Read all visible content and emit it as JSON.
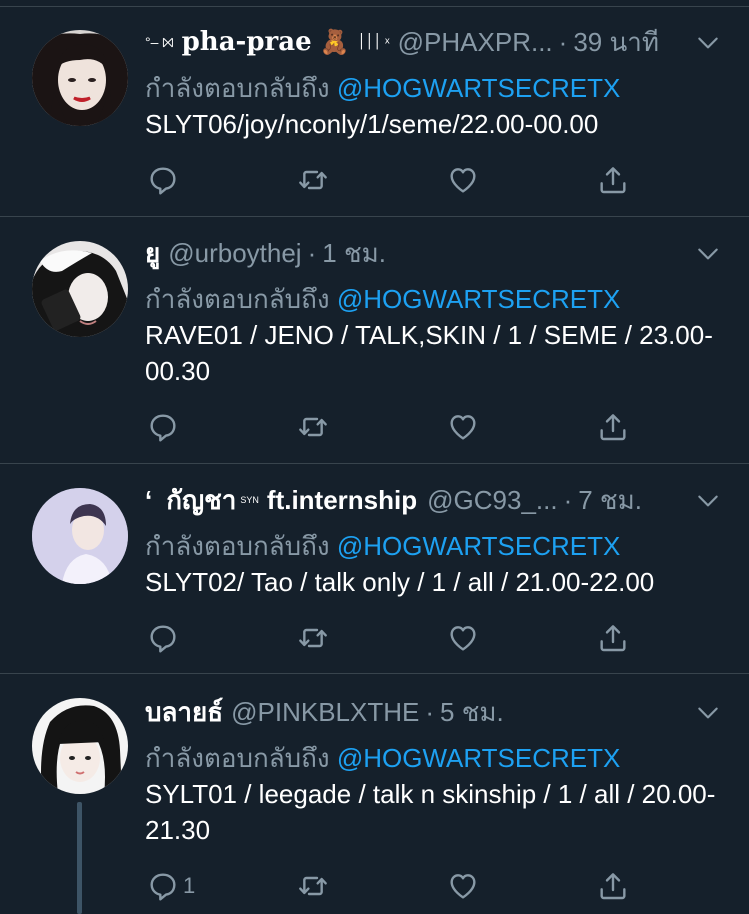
{
  "ui": {
    "colors": {
      "background": "#15202b",
      "divider": "#38444d",
      "muted_text": "#8899a6",
      "mention": "#1da1f2",
      "text": "#ffffff"
    },
    "icons": {
      "reply": "reply-icon",
      "retweet": "retweet-icon",
      "like": "like-icon",
      "share": "share-icon",
      "more": "chevron-down-icon"
    }
  },
  "tweets": [
    {
      "name_prefix": "°– ⨝",
      "display_name": "pha-prae",
      "name_emoji": "🧸",
      "name_suffix": "׀׀׀ ˣ",
      "handle": "@PHAXPR...",
      "dot": "·",
      "time": "39 นาที",
      "reply_prefix": "กำลังตอบกลับถึง",
      "reply_to": "@HOGWARTSECRETX",
      "text": "SLYT06/joy/nconly/1/seme/22.00-00.00",
      "reply_count": ""
    },
    {
      "display_name": "ยู",
      "handle": "@urboythej",
      "dot": "·",
      "time": "1 ชม.",
      "reply_prefix": "กำลังตอบกลับถึง",
      "reply_to": "@HOGWARTSECRETX",
      "text": "RAVE01 / JENO / TALK,SKIN / 1 / SEME / 23.00-00.30",
      "reply_count": ""
    },
    {
      "name_prefix": "‘",
      "display_name": "กัญชา",
      "name_tag": "SYN",
      "name_suffix": "ft.internship",
      "handle": "@GC93_...",
      "dot": "·",
      "time": "7 ชม.",
      "reply_prefix": "กำลังตอบกลับถึง",
      "reply_to": "@HOGWARTSECRETX",
      "text": "SLYT02/ Tao / talk only / 1 / all / 21.00-22.00",
      "reply_count": ""
    },
    {
      "display_name": "บลายธ์",
      "handle": "@PINKBLXTHE",
      "dot": "·",
      "time": "5 ชม.",
      "reply_prefix": "กำลังตอบกลับถึง",
      "reply_to": "@HOGWARTSECRETX",
      "text": "SYLT01 / leegade / talk n skinship / 1 / all / 20.00-21.30",
      "reply_count": "1"
    }
  ]
}
